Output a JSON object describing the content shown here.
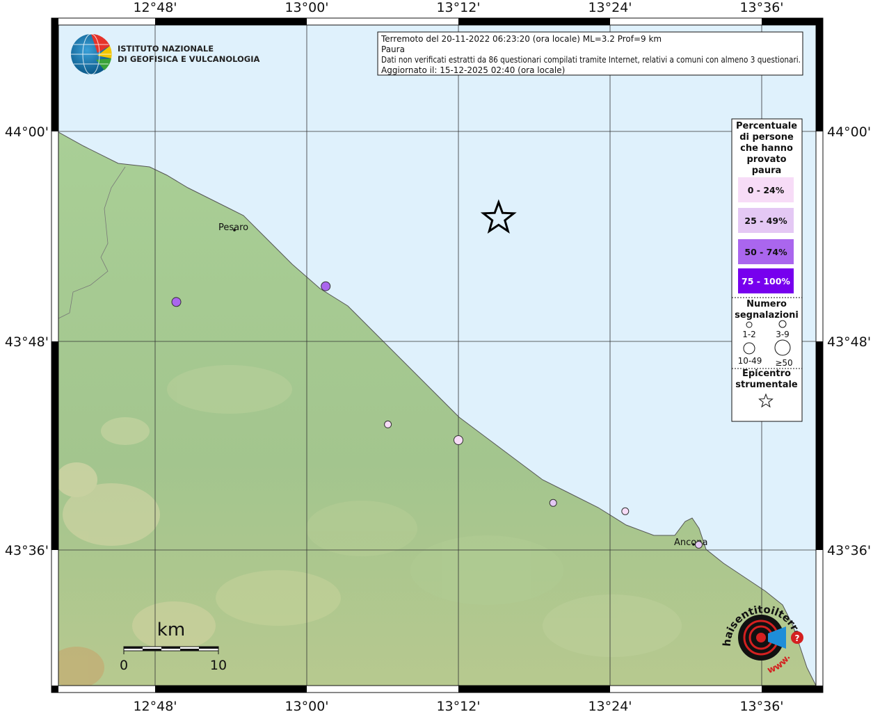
{
  "info_box": {
    "line1": "Terremoto del 20-11-2022 06:23:20 (ora locale) ML=3.2 Prof=9 km",
    "line2": "Paura",
    "line3": "Dati non verificati estratti da 86 questionari compilati tramite Internet, relativi a comuni con almeno 3 questionari.",
    "line4": "Aggiornato il: 15-12-2025 02:40 (ora locale)"
  },
  "institute": {
    "line1": "ISTITUTO NAZIONALE",
    "line2": "DI GEOFISICA E VULCANOLOGIA"
  },
  "axes": {
    "lon_ticks": [
      "12°48'",
      "13°00'",
      "13°12'",
      "13°24'",
      "13°36'"
    ],
    "lat_ticks": [
      "44°00'",
      "43°48'",
      "43°36'"
    ]
  },
  "cities": [
    {
      "name": "Pesaro"
    },
    {
      "name": "Ancona"
    }
  ],
  "legend": {
    "title_lines": [
      "Percentuale",
      "di persone",
      "che hanno",
      "provato",
      "paura"
    ],
    "categories": [
      {
        "label": "0 - 24%",
        "color": "#f7dcf7",
        "text_color": "#111111"
      },
      {
        "label": "25 - 49%",
        "color": "#e4c8f4",
        "text_color": "#111111"
      },
      {
        "label": "50 - 74%",
        "color": "#aa66ee",
        "text_color": "#111111"
      },
      {
        "label": "75 - 100%",
        "color": "#7700ee",
        "text_color": "#ffffff"
      }
    ],
    "count_title_lines": [
      "Numero",
      "segnalazioni"
    ],
    "count_labels": [
      "1-2",
      "3-9",
      "10-49",
      "≥50"
    ],
    "epicenter_title_lines": [
      "Epicentro",
      "strumentale"
    ]
  },
  "scale": {
    "unit": "km",
    "min_label": "0",
    "max_label": "10"
  },
  "reports": [
    {
      "lon": 12.828,
      "lat": 43.837,
      "category": 2
    },
    {
      "lon": 13.025,
      "lat": 43.852,
      "category": 2
    },
    {
      "lon": 13.107,
      "lat": 43.72,
      "category": 0
    },
    {
      "lon": 13.2,
      "lat": 43.705,
      "category": 0
    },
    {
      "lon": 13.325,
      "lat": 43.645,
      "category": 1
    },
    {
      "lon": 13.42,
      "lat": 43.637,
      "category": 0
    },
    {
      "lon": 13.517,
      "lat": 43.605,
      "category": 1
    }
  ],
  "epicenter": {
    "lon": 13.253,
    "lat": 43.917
  },
  "colors": {
    "sea": "#dff1fc",
    "land": "#9cc68c"
  },
  "badge": {
    "text": "haisentitoilterremoto.it",
    "url_text": "www."
  }
}
